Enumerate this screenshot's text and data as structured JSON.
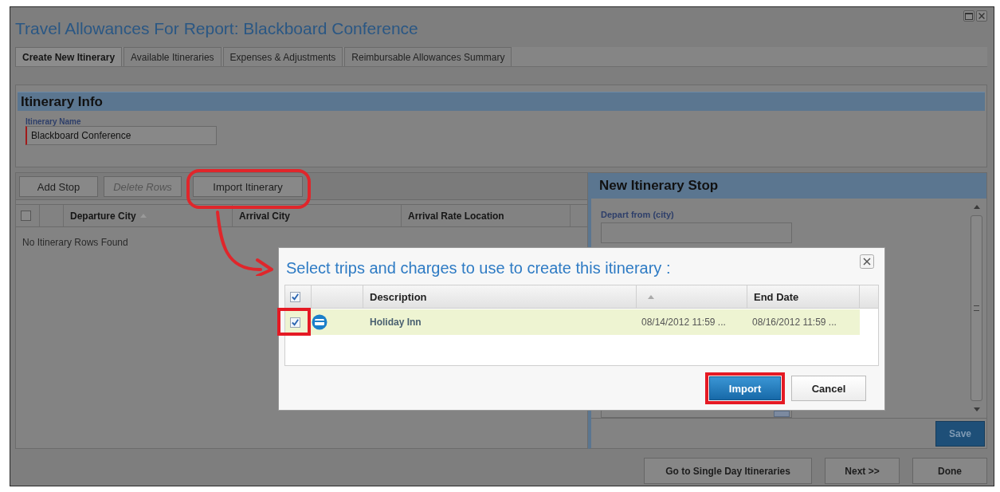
{
  "window": {
    "title": "Travel Allowances For Report: Blackboard Conference"
  },
  "tabs": [
    {
      "label": "Create New Itinerary",
      "selected": true
    },
    {
      "label": "Available Itineraries",
      "selected": false
    },
    {
      "label": "Expenses & Adjustments",
      "selected": false
    },
    {
      "label": "Reimbursable Allowances Summary",
      "selected": false
    }
  ],
  "itinerary_info": {
    "heading": "Itinerary Info",
    "name_label": "Itinerary Name",
    "name_value": "Blackboard Conference"
  },
  "toolbar": [
    {
      "label": "Add Stop",
      "disabled": false
    },
    {
      "label": "Delete Rows",
      "disabled": true
    },
    {
      "label": "Import Itinerary",
      "disabled": false
    }
  ],
  "itinerary_table": {
    "select_all_checked": false,
    "columns": [
      "Departure City",
      "Arrival City",
      "Arrival Rate Location"
    ],
    "empty_message": "No Itinerary Rows Found"
  },
  "new_stop": {
    "heading": "New Itinerary Stop",
    "depart_label": "Depart from (city)",
    "save": "Save"
  },
  "footer_buttons": [
    "Go to Single Day Itineraries",
    "Next >>",
    "Done"
  ],
  "dialog": {
    "title": "Select trips and charges to use to create this itinerary :",
    "select_all_checked": true,
    "columns": {
      "description": "Description",
      "end_date": "End Date"
    },
    "rows": [
      {
        "checked": true,
        "description": "Holiday Inn",
        "column_4": "08/14/2012 11:59 ...",
        "end_date": "08/16/2012 11:59 ..."
      }
    ],
    "import": "Import",
    "cancel": "Cancel"
  }
}
